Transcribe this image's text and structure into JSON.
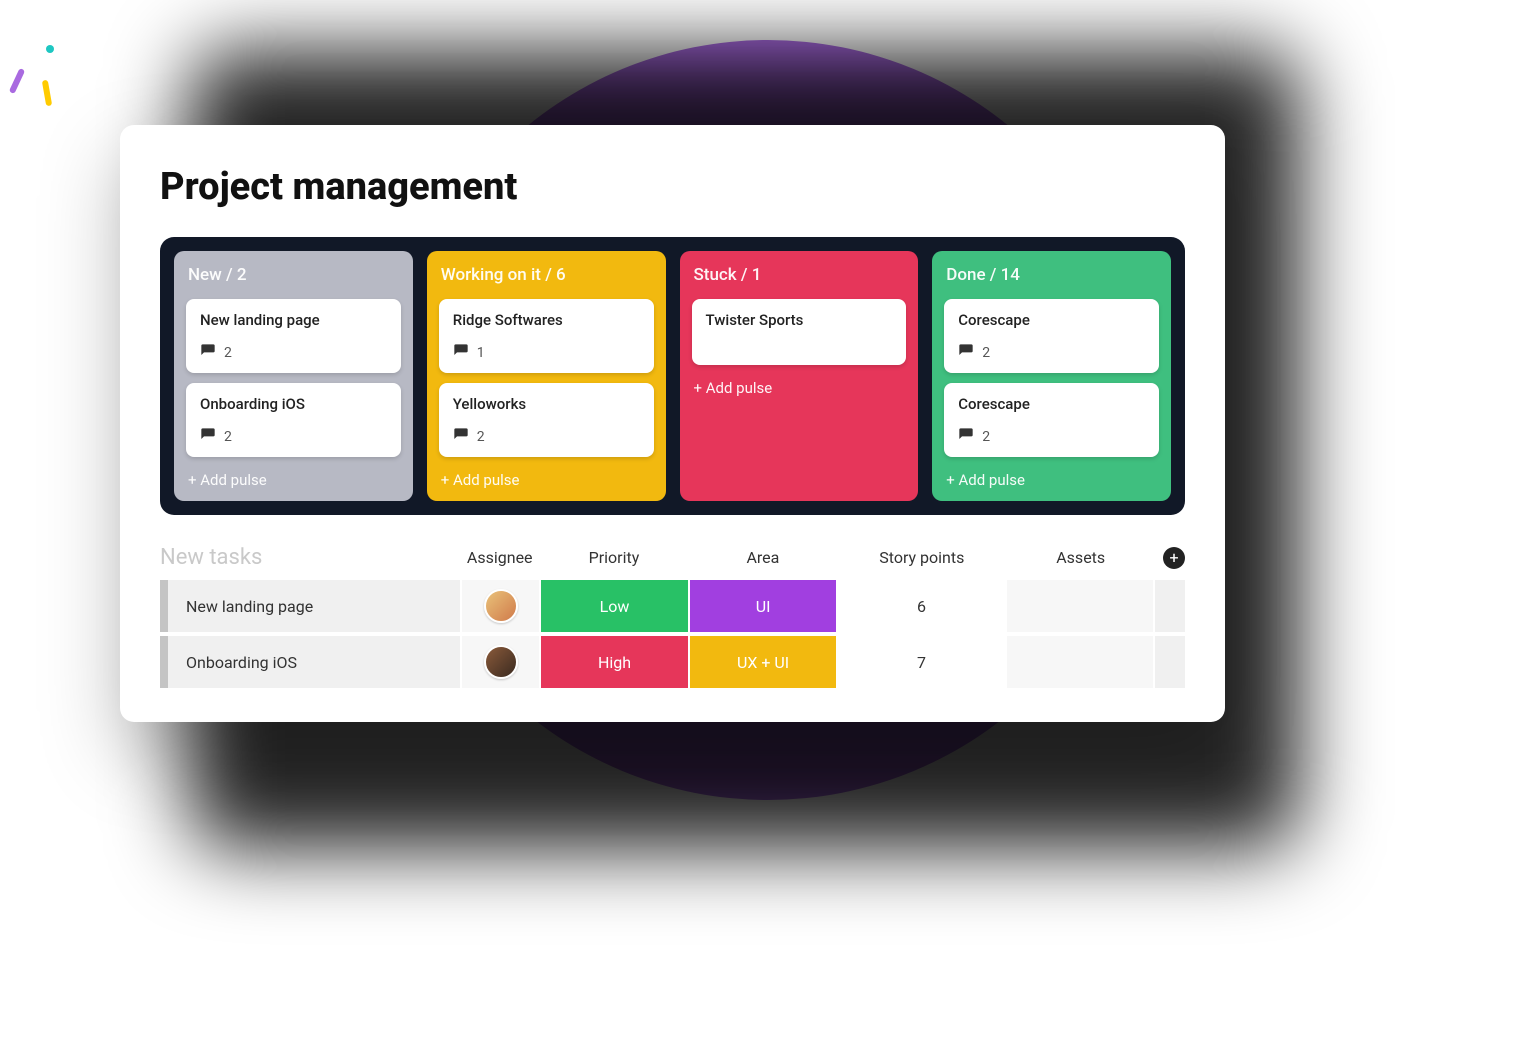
{
  "page": {
    "title": "Project management"
  },
  "board": {
    "add_pulse_label": "+ Add pulse",
    "columns": [
      {
        "id": "new",
        "header": "New / 2",
        "color": "#b7b9c4",
        "cards": [
          {
            "title": "New landing page",
            "comments": "2"
          },
          {
            "title": "Onboarding iOS",
            "comments": "2"
          }
        ]
      },
      {
        "id": "working",
        "header": "Working on it / 6",
        "color": "#f2b90f",
        "cards": [
          {
            "title": "Ridge Softwares",
            "comments": "1"
          },
          {
            "title": "Yelloworks",
            "comments": "2"
          }
        ]
      },
      {
        "id": "stuck",
        "header": "Stuck / 1",
        "color": "#e6365a",
        "cards": [
          {
            "title": "Twister Sports"
          }
        ]
      },
      {
        "id": "done",
        "header": "Done / 14",
        "color": "#3fbf7f",
        "cards": [
          {
            "title": "Corescape",
            "comments": "2"
          },
          {
            "title": "Corescape",
            "comments": "2"
          }
        ]
      }
    ]
  },
  "tasks": {
    "section_title": "New tasks",
    "headers": {
      "assignee": "Assignee",
      "priority": "Priority",
      "area": "Area",
      "story_points": "Story points",
      "assets": "Assets"
    },
    "rows": [
      {
        "name": "New landing page",
        "priority": {
          "label": "Low",
          "color": "#28c166"
        },
        "area": {
          "label": "UI",
          "color": "#a13fe0"
        },
        "points": "6"
      },
      {
        "name": "Onboarding iOS",
        "priority": {
          "label": "High",
          "color": "#e6365a"
        },
        "area": {
          "label": "UX + UI",
          "color": "#f2b90f"
        },
        "points": "7"
      }
    ]
  },
  "colors": {
    "accent_purple": "#a96ae0"
  }
}
